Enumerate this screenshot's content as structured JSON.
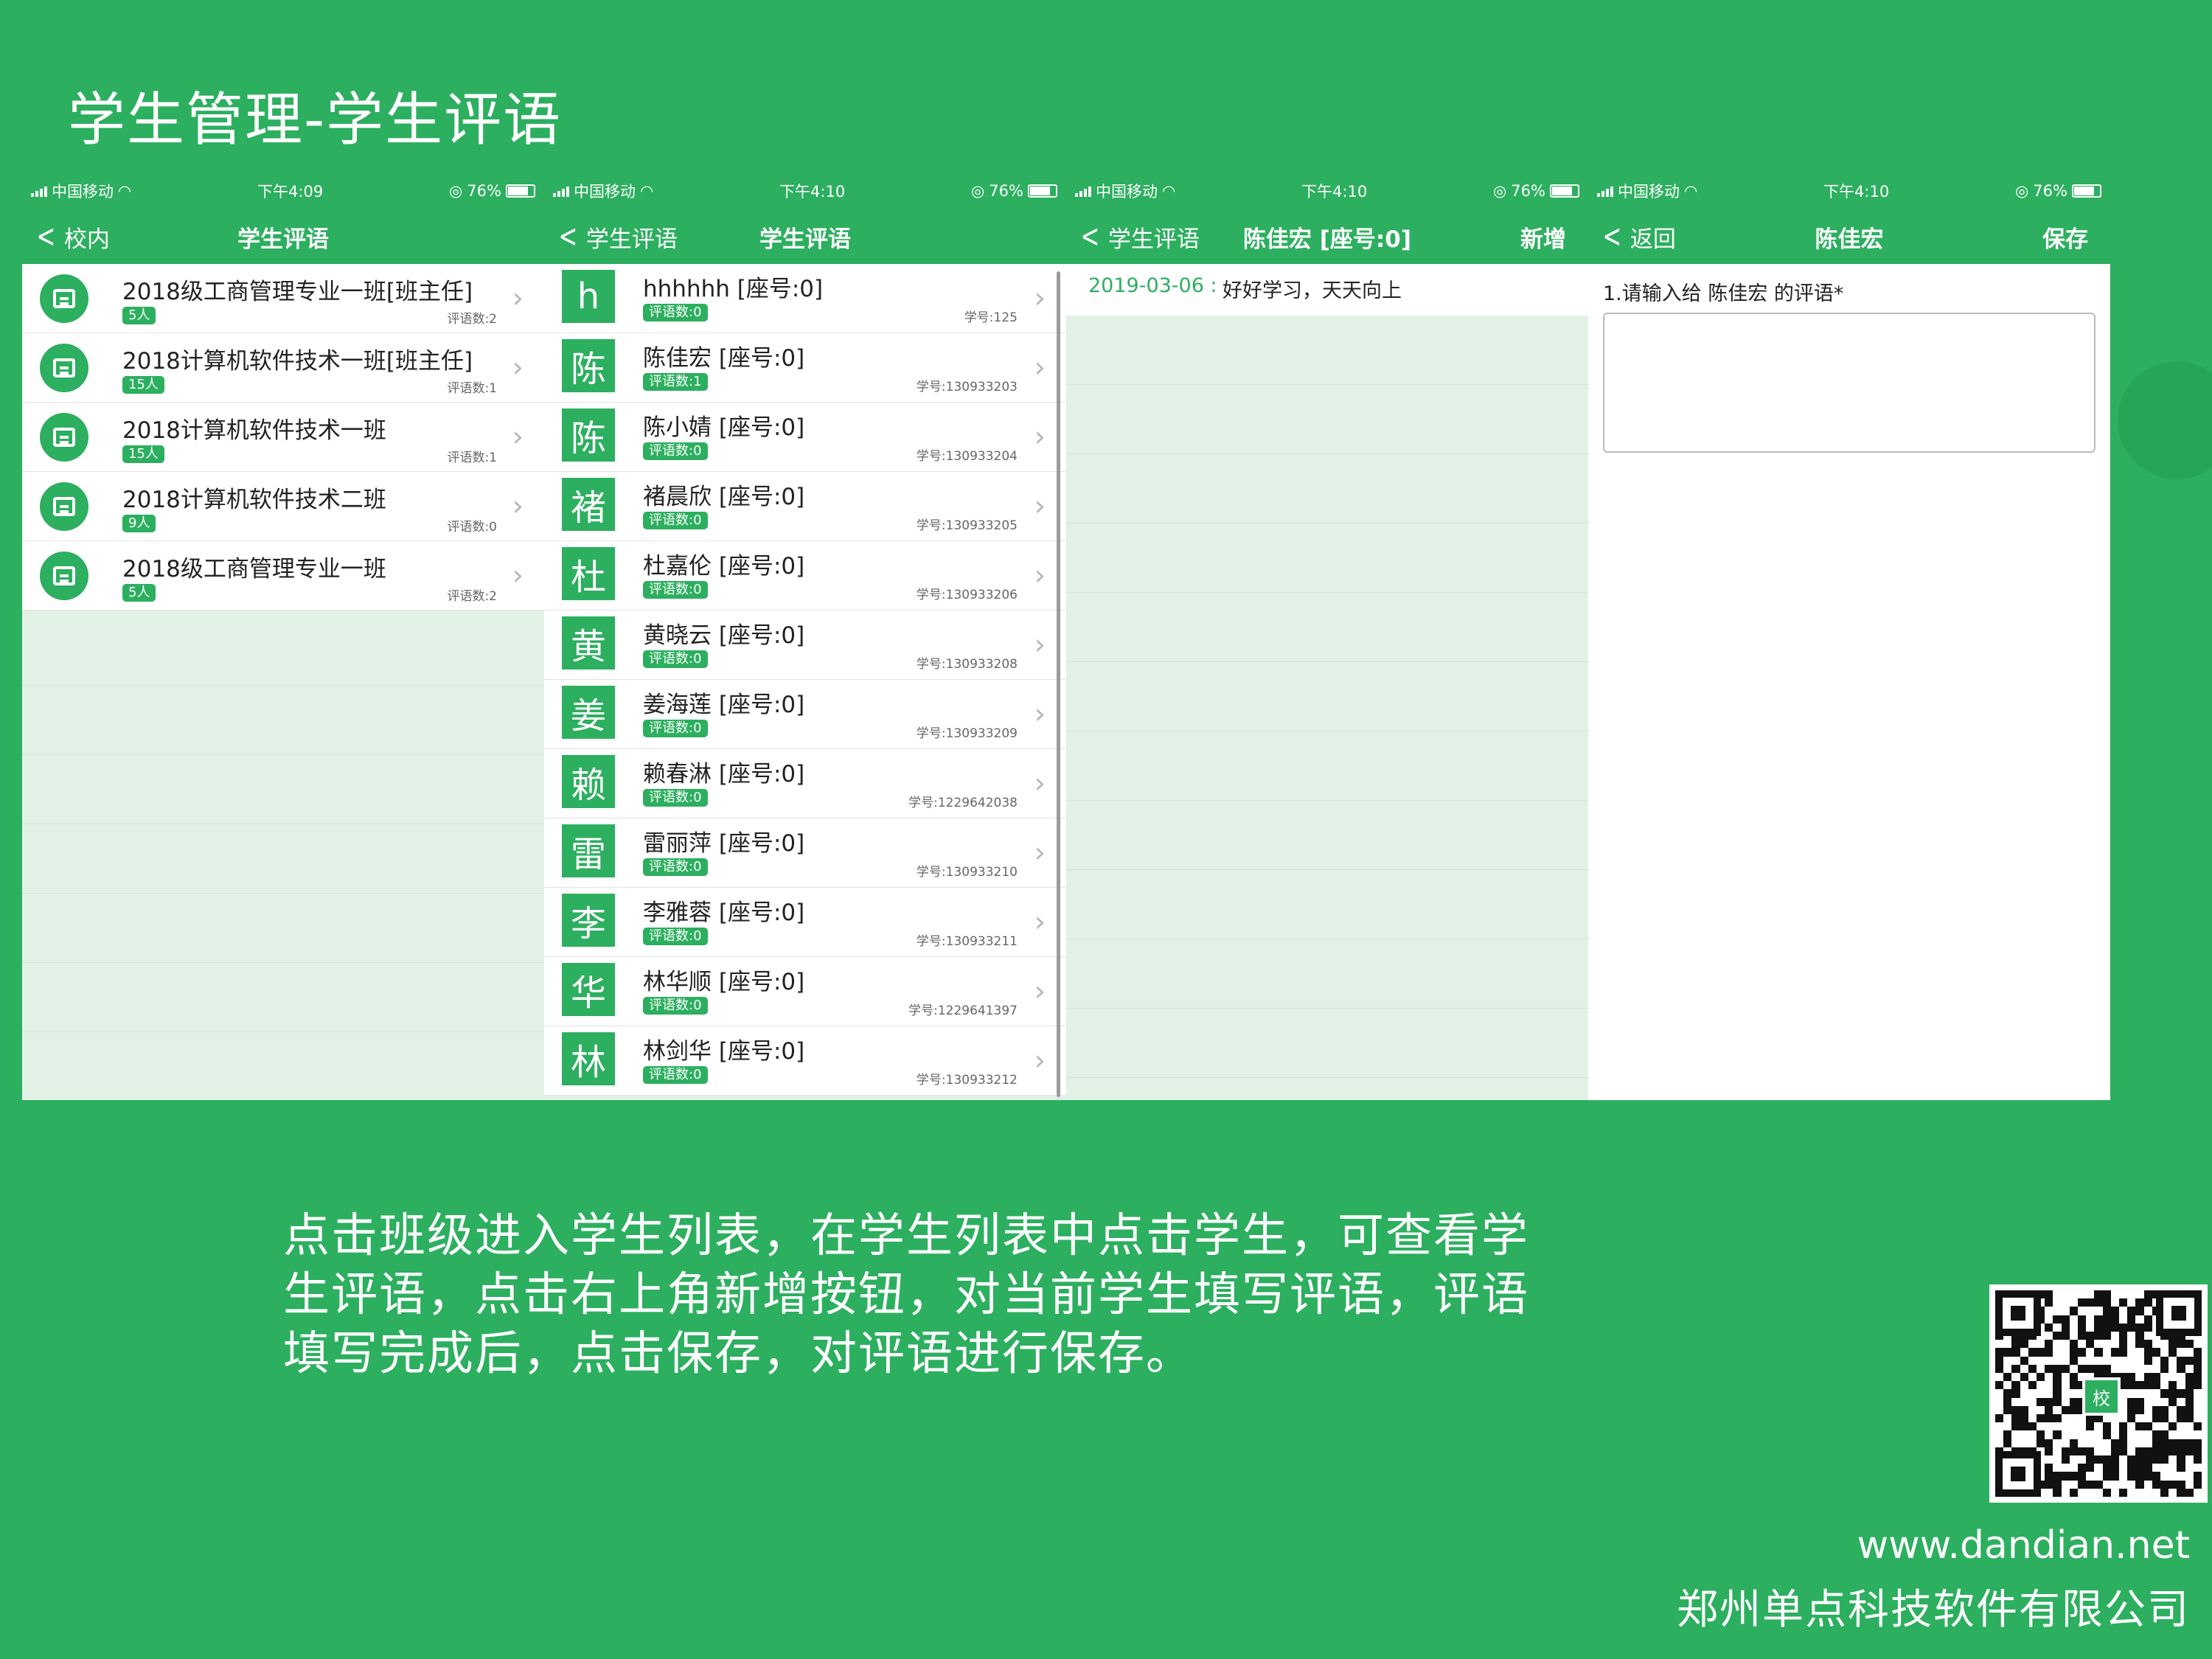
{
  "slide": {
    "title": "学生管理-学生评语",
    "description": "点击班级进入学生列表，在学生列表中点击学生，可查看学生评语，点击右上角新增按钮，对当前学生填写评语，评语填写完成后，点击保存，对评语进行保存。",
    "website": "www.dandian.net",
    "company": "郑州单点科技软件有限公司",
    "qr_logo": "校"
  },
  "screens": [
    {
      "status": {
        "carrier": "中国移动",
        "time": "下午4:09",
        "battery": "76%"
      },
      "nav": {
        "back": "校内",
        "title": "学生评语",
        "right": ""
      },
      "classes": [
        {
          "name": "2018级工商管理专业一班[班主任]",
          "count": "5人",
          "comments": "评语数:2"
        },
        {
          "name": "2018计算机软件技术一班[班主任]",
          "count": "15人",
          "comments": "评语数:1"
        },
        {
          "name": "2018计算机软件技术一班",
          "count": "15人",
          "comments": "评语数:1"
        },
        {
          "name": "2018计算机软件技术二班",
          "count": "9人",
          "comments": "评语数:0"
        },
        {
          "name": "2018级工商管理专业一班",
          "count": "5人",
          "comments": "评语数:2"
        }
      ]
    },
    {
      "status": {
        "carrier": "中国移动",
        "time": "下午4:10",
        "battery": "76%"
      },
      "nav": {
        "back": "学生评语",
        "title": "学生评语",
        "right": ""
      },
      "students": [
        {
          "avatar": "h",
          "name": "hhhhhh [座号:0]",
          "comments": "评语数:0",
          "id": "学号:125"
        },
        {
          "avatar": "陈",
          "name": "陈佳宏 [座号:0]",
          "comments": "评语数:1",
          "id": "学号:130933203"
        },
        {
          "avatar": "陈",
          "name": "陈小婧 [座号:0]",
          "comments": "评语数:0",
          "id": "学号:130933204"
        },
        {
          "avatar": "褚",
          "name": "褚晨欣 [座号:0]",
          "comments": "评语数:0",
          "id": "学号:130933205"
        },
        {
          "avatar": "杜",
          "name": "杜嘉伦 [座号:0]",
          "comments": "评语数:0",
          "id": "学号:130933206"
        },
        {
          "avatar": "黄",
          "name": "黄晓云 [座号:0]",
          "comments": "评语数:0",
          "id": "学号:130933208"
        },
        {
          "avatar": "姜",
          "name": "姜海莲 [座号:0]",
          "comments": "评语数:0",
          "id": "学号:130933209"
        },
        {
          "avatar": "赖",
          "name": "赖春淋 [座号:0]",
          "comments": "评语数:0",
          "id": "学号:1229642038"
        },
        {
          "avatar": "雷",
          "name": "雷丽萍 [座号:0]",
          "comments": "评语数:0",
          "id": "学号:130933210"
        },
        {
          "avatar": "李",
          "name": "李雅蓉 [座号:0]",
          "comments": "评语数:0",
          "id": "学号:130933211"
        },
        {
          "avatar": "华",
          "name": "林华顺 [座号:0]",
          "comments": "评语数:0",
          "id": "学号:1229641397"
        },
        {
          "avatar": "林",
          "name": "林剑华 [座号:0]",
          "comments": "评语数:0",
          "id": "学号:130933212"
        }
      ]
    },
    {
      "status": {
        "carrier": "中国移动",
        "time": "下午4:10",
        "battery": "76%"
      },
      "nav": {
        "back": "学生评语",
        "title": "陈佳宏 [座号:0]",
        "right": "新增"
      },
      "comment": {
        "date": "2019-03-06 :",
        "text": "好好学习，天天向上"
      }
    },
    {
      "status": {
        "carrier": "中国移动",
        "time": "下午4:10",
        "battery": "76%"
      },
      "nav": {
        "back": "返回",
        "title": "陈佳宏",
        "right": "保存"
      },
      "form": {
        "label": "1.请输入给 陈佳宏 的评语*",
        "value": ""
      }
    }
  ]
}
